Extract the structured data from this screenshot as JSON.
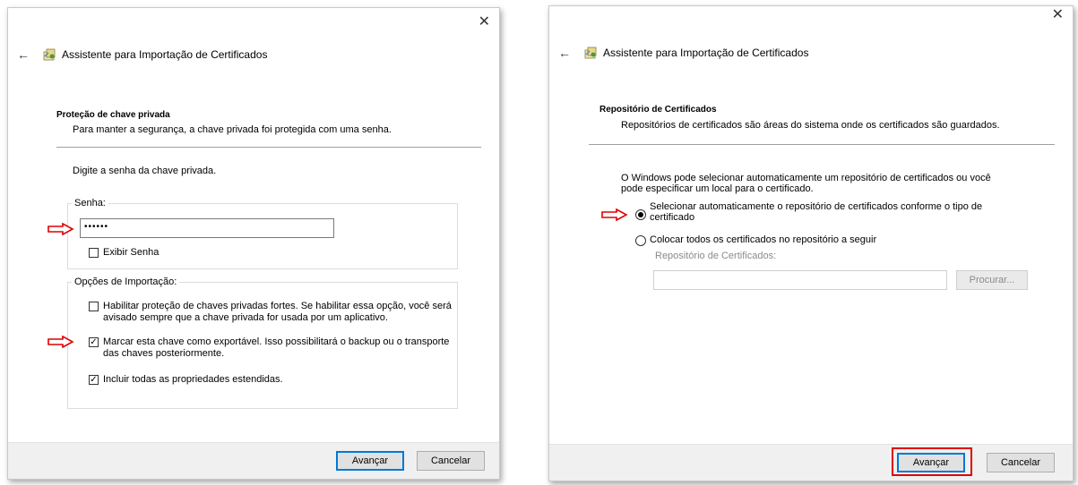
{
  "common": {
    "window_title": "Assistente para Importação de Certificados",
    "next_label": "Avançar",
    "cancel_label": "Cancelar",
    "close_glyph": "✕",
    "back_glyph": "←"
  },
  "left": {
    "section_title": "Proteção de chave privada",
    "section_desc": "Para manter a segurança, a chave privada foi protegida com uma senha.",
    "prompt": "Digite a senha da chave privada.",
    "password_group_label": "Senha:",
    "password_value": "••••••",
    "show_password_label": "Exibir Senha",
    "show_password_checked": false,
    "options_group_label": "Opções de Importação:",
    "options": [
      {
        "label_line1": "Habilitar proteção de chaves privadas fortes. Se habilitar essa opção, você será",
        "label_line2": "avisado sempre que a chave privada for usada por um aplicativo.",
        "checked": false,
        "check_glyph": ""
      },
      {
        "label_line1": "Marcar esta chave como exportável. Isso possibilitará o backup ou o transporte",
        "label_line2": "das chaves posteriormente.",
        "checked": true,
        "check_glyph": "✓"
      },
      {
        "label_line1": "Incluir todas as propriedades estendidas.",
        "label_line2": "",
        "checked": true,
        "check_glyph": "✓"
      }
    ]
  },
  "right": {
    "section_title": "Repositório de Certificados",
    "section_desc": "Repositórios de certificados são áreas do sistema onde os certificados são guardados.",
    "intro_line1": "O Windows pode selecionar automaticamente um repositório de certificados ou você",
    "intro_line2": "pode especificar um local para o certificado.",
    "radio_auto_line1": "Selecionar automaticamente o repositório de certificados conforme o tipo de",
    "radio_auto_line2": "certificado",
    "radio_auto_selected": true,
    "radio_manual_label": "Colocar todos os certificados no repositório a seguir",
    "radio_manual_selected": false,
    "store_label": "Repositório de Certificados:",
    "store_value": "",
    "browse_label": "Procurar..."
  },
  "colors": {
    "annotation_red": "#e00000",
    "focus_blue": "#0078d7"
  }
}
